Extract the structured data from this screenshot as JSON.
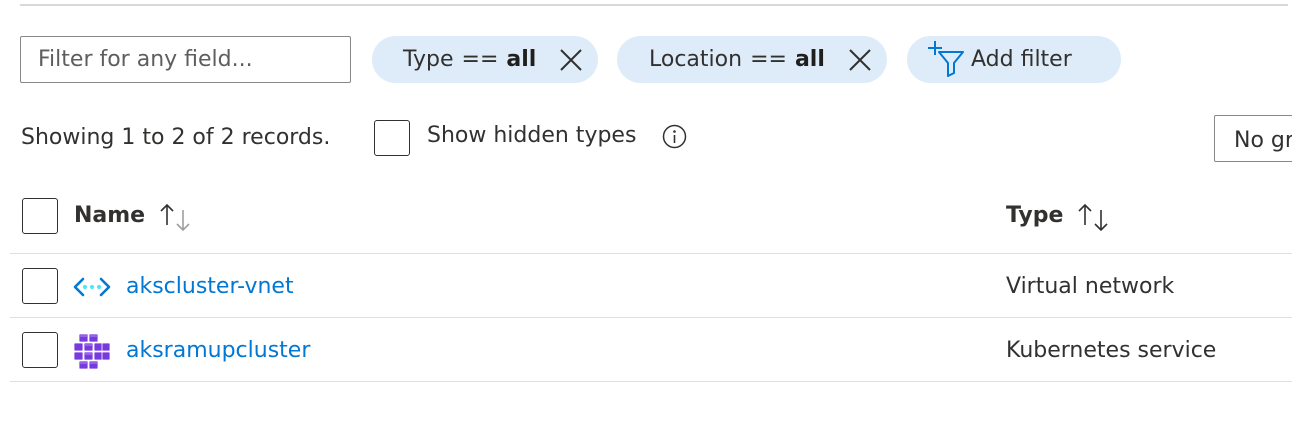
{
  "filter": {
    "placeholder": "Filter for any field..."
  },
  "pills": {
    "type": {
      "key": "Type",
      "op": "==",
      "value": "all"
    },
    "location": {
      "key": "Location",
      "op": "==",
      "value": "all"
    },
    "add_label": "Add filter"
  },
  "info": {
    "records_text": "Showing 1 to 2 of 2 records.",
    "show_hidden_label": "Show hidden types",
    "show_hidden_checked": false,
    "grouping_value": "No grouping"
  },
  "table": {
    "columns": [
      {
        "label": "Name",
        "sort": "ascending"
      },
      {
        "label": "Type",
        "sort": "sortable"
      }
    ],
    "rows": [
      {
        "icon": "virtual-network-icon",
        "name": "akscluster-vnet",
        "type": "Virtual network"
      },
      {
        "icon": "kubernetes-service-icon",
        "name": "aksramupcluster",
        "type": "Kubernetes service"
      }
    ]
  },
  "colors": {
    "link": "#0078d4",
    "pill_bg": "#deecf9",
    "vnet_arrows": "#0078d4",
    "vnet_dots": "#50e6ff",
    "aks_purple": "#773adc"
  }
}
